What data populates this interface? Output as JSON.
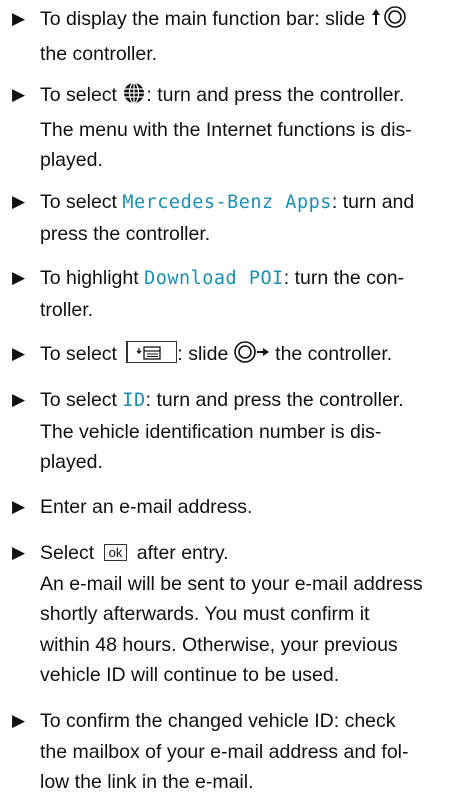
{
  "bullet": "▶",
  "steps": [
    {
      "l1_pre": "To display the main function bar: slide ",
      "l2": "the controller."
    },
    {
      "l1_pre": "To select ",
      "l1_post": ": turn and press the controller.",
      "l2": "The menu with the Internet functions is dis-",
      "l3": "played."
    },
    {
      "l1_pre": "To select ",
      "l1_hl": "Mercedes-Benz Apps",
      "l1_post": ": turn and",
      "l2": "press the controller."
    },
    {
      "l1_pre": "To highlight ",
      "l1_hl": "Download POI",
      "l1_post": ": turn the con-",
      "l2": "troller."
    },
    {
      "l1_pre": "To select ",
      "l1_post": ": slide ",
      "l1_end": " the controller."
    },
    {
      "l1_pre": "To select ",
      "l1_hl": "ID",
      "l1_post": ": turn and press the controller.",
      "l2": "The vehicle identification number is dis-",
      "l3": "played."
    },
    {
      "l1": "Enter an e-mail address."
    },
    {
      "l1_pre": "Select ",
      "l1_key": "ok",
      "l1_post": " after entry.",
      "l2": "An e-mail will be sent to your e-mail address",
      "l3": "shortly afterwards. You must confirm it",
      "l4": "within 48 hours. Otherwise, your previous",
      "l5": "vehicle ID will continue to be used."
    },
    {
      "l1": "To confirm the changed vehicle ID: check",
      "l2": "the mailbox of your e-mail address and fol-",
      "l3": "low the link in the e-mail."
    }
  ]
}
